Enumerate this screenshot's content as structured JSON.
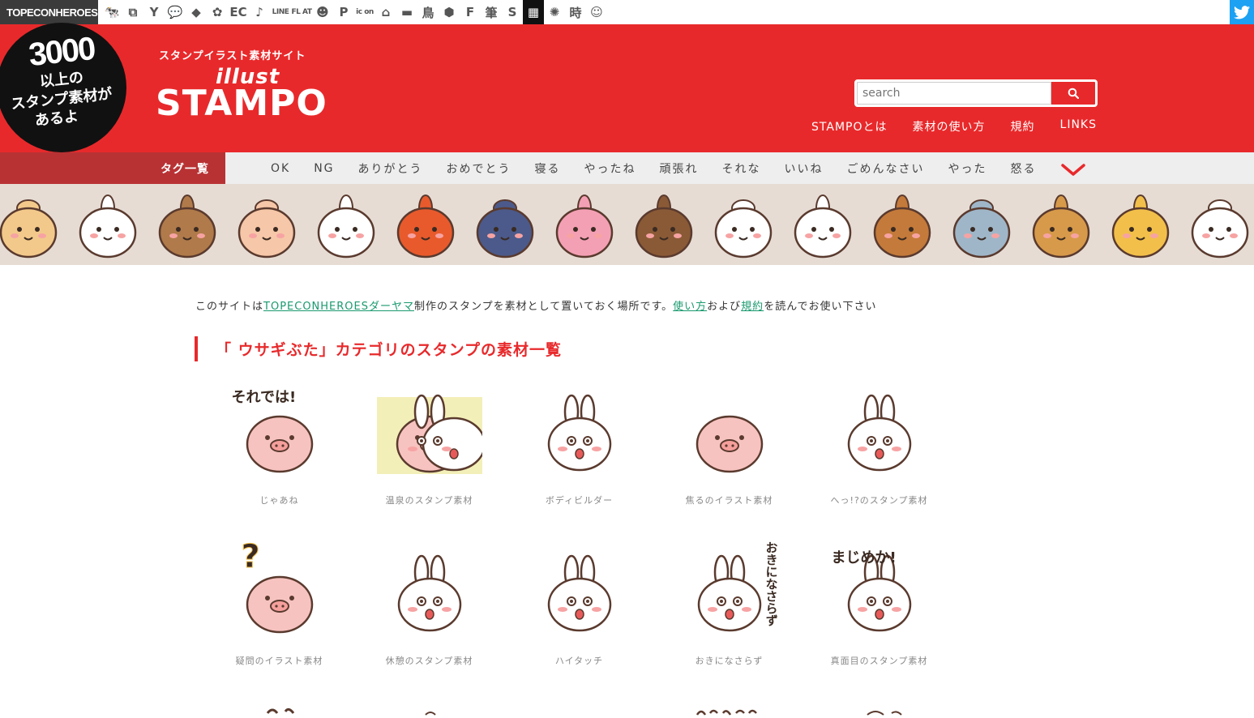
{
  "network_bar": {
    "brand": "TOPECONHEROES",
    "icons": [
      {
        "name": "animal-icon",
        "glyph": "🐄"
      },
      {
        "name": "copy-icon",
        "glyph": "⧉"
      },
      {
        "name": "person-icon",
        "glyph": "Y"
      },
      {
        "name": "chat-icon",
        "glyph": "💬"
      },
      {
        "name": "bird-icon",
        "glyph": "◆"
      },
      {
        "name": "flower-icon",
        "glyph": "✿"
      },
      {
        "name": "ec-icon",
        "glyph": "EC"
      },
      {
        "name": "music-icon",
        "glyph": "♪"
      },
      {
        "name": "line-icon",
        "glyph": "LINE"
      },
      {
        "name": "flat-icon",
        "glyph": "FL AT"
      },
      {
        "name": "smile-icon",
        "glyph": "☻"
      },
      {
        "name": "parking-icon",
        "glyph": "P"
      },
      {
        "name": "icon-on-icon",
        "glyph": "ic on"
      },
      {
        "name": "building-icon",
        "glyph": "⌂"
      },
      {
        "name": "car-icon",
        "glyph": "▬"
      },
      {
        "name": "tori-icon",
        "glyph": "鳥"
      },
      {
        "name": "pattern-icon",
        "glyph": "⬢"
      },
      {
        "name": "f-icon",
        "glyph": "F"
      },
      {
        "name": "brush-icon",
        "glyph": "筆"
      },
      {
        "name": "s-icon",
        "glyph": "S"
      },
      {
        "name": "grid-icon",
        "glyph": "▦"
      },
      {
        "name": "burst-icon",
        "glyph": "✺"
      },
      {
        "name": "clock-kanji-icon",
        "glyph": "時"
      },
      {
        "name": "face-icon",
        "glyph": "☺"
      }
    ]
  },
  "header": {
    "badge_number": "3000",
    "badge_line1": "以上の",
    "badge_line2": "スタンプ素材が",
    "badge_line3": "あるよ",
    "tagline": "スタンプイラスト素材サイト",
    "logo_small": "illust",
    "logo": "STAMPO",
    "search_placeholder": "search",
    "nav": [
      "STAMPOとは",
      "素材の使い方",
      "規約",
      "LINKS"
    ]
  },
  "tagbar": {
    "label": "タグ一覧",
    "tags": [
      "OK",
      "NG",
      "ありがとう",
      "おめでとう",
      "寝る",
      "やったね",
      "頑張れ",
      "それな",
      "いいね",
      "ごめんなさい",
      "やった",
      "怒る"
    ]
  },
  "banner": {
    "characters": [
      "hamster",
      "panda",
      "bears",
      "sumo",
      "rabbit-pig",
      "octopus",
      "penguin",
      "pink-rabbit",
      "boar",
      "radish",
      "cow",
      "squirrel",
      "koala",
      "dog",
      "lion",
      "cat"
    ]
  },
  "intro": {
    "prefix": "このサイトは",
    "link1": "TOPECONHEROESダーヤマ",
    "middle": "制作のスタンプを素材として置いておく場所です。",
    "link2": "使い方",
    "and": "および",
    "link3": "規約",
    "suffix": "を読んでお使い下さい"
  },
  "category_heading": "「 ウサギぶた」カテゴリのスタンプの素材一覧",
  "items": [
    {
      "caption": "じゃあね",
      "overlay": "それでは!"
    },
    {
      "caption": "温泉のスタンプ素材",
      "overlay": ""
    },
    {
      "caption": "ボディビルダー",
      "overlay": ""
    },
    {
      "caption": "焦るのイラスト素材",
      "overlay": ""
    },
    {
      "caption": "へっ!?のスタンプ素材",
      "overlay": ""
    },
    {
      "caption": "疑問のイラスト素材",
      "overlay": "?"
    },
    {
      "caption": "休憩のスタンプ素材",
      "overlay": ""
    },
    {
      "caption": "ハイタッチ",
      "overlay": ""
    },
    {
      "caption": "おきになさらず",
      "overlay": "おきになさらず"
    },
    {
      "caption": "真面目のスタンプ素材",
      "overlay": "まじめか!"
    }
  ],
  "colors": {
    "brand_red": "#e8292b",
    "tag_label": "#b83234",
    "strip": "#e6dcd4",
    "link": "#1a9a6e",
    "twitter": "#1da1f2"
  }
}
